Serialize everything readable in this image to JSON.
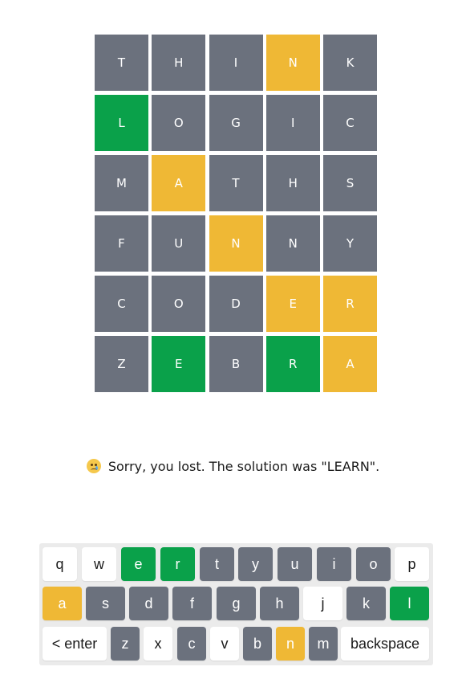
{
  "board": {
    "rows": [
      [
        {
          "letter": "T",
          "state": "absent"
        },
        {
          "letter": "H",
          "state": "absent"
        },
        {
          "letter": "I",
          "state": "absent"
        },
        {
          "letter": "N",
          "state": "present"
        },
        {
          "letter": "K",
          "state": "absent"
        }
      ],
      [
        {
          "letter": "L",
          "state": "correct"
        },
        {
          "letter": "O",
          "state": "absent"
        },
        {
          "letter": "G",
          "state": "absent"
        },
        {
          "letter": "I",
          "state": "absent"
        },
        {
          "letter": "C",
          "state": "absent"
        }
      ],
      [
        {
          "letter": "M",
          "state": "absent"
        },
        {
          "letter": "A",
          "state": "present"
        },
        {
          "letter": "T",
          "state": "absent"
        },
        {
          "letter": "H",
          "state": "absent"
        },
        {
          "letter": "S",
          "state": "absent"
        }
      ],
      [
        {
          "letter": "F",
          "state": "absent"
        },
        {
          "letter": "U",
          "state": "absent"
        },
        {
          "letter": "N",
          "state": "present"
        },
        {
          "letter": "N",
          "state": "absent"
        },
        {
          "letter": "Y",
          "state": "absent"
        }
      ],
      [
        {
          "letter": "C",
          "state": "absent"
        },
        {
          "letter": "O",
          "state": "absent"
        },
        {
          "letter": "D",
          "state": "absent"
        },
        {
          "letter": "E",
          "state": "present"
        },
        {
          "letter": "R",
          "state": "present"
        }
      ],
      [
        {
          "letter": "Z",
          "state": "absent"
        },
        {
          "letter": "E",
          "state": "correct"
        },
        {
          "letter": "B",
          "state": "absent"
        },
        {
          "letter": "R",
          "state": "correct"
        },
        {
          "letter": "A",
          "state": "present"
        }
      ]
    ]
  },
  "message": {
    "emoji_icon": "crying-face-icon",
    "text": "Sorry, you lost. The solution was \"LEARN\"."
  },
  "keyboard": {
    "rows": [
      [
        {
          "label": "q",
          "state": "unused"
        },
        {
          "label": "w",
          "state": "unused"
        },
        {
          "label": "e",
          "state": "correct"
        },
        {
          "label": "r",
          "state": "correct"
        },
        {
          "label": "t",
          "state": "absent"
        },
        {
          "label": "y",
          "state": "absent"
        },
        {
          "label": "u",
          "state": "absent"
        },
        {
          "label": "i",
          "state": "absent"
        },
        {
          "label": "o",
          "state": "absent"
        },
        {
          "label": "p",
          "state": "unused"
        }
      ],
      [
        {
          "label": "a",
          "state": "present"
        },
        {
          "label": "s",
          "state": "absent"
        },
        {
          "label": "d",
          "state": "absent"
        },
        {
          "label": "f",
          "state": "absent"
        },
        {
          "label": "g",
          "state": "absent"
        },
        {
          "label": "h",
          "state": "absent"
        },
        {
          "label": "j",
          "state": "unused"
        },
        {
          "label": "k",
          "state": "absent"
        },
        {
          "label": "l",
          "state": "correct"
        }
      ],
      [
        {
          "label": "< enter",
          "state": "unused",
          "role": "enter"
        },
        {
          "label": "z",
          "state": "absent"
        },
        {
          "label": "x",
          "state": "unused"
        },
        {
          "label": "c",
          "state": "absent"
        },
        {
          "label": "v",
          "state": "unused"
        },
        {
          "label": "b",
          "state": "absent"
        },
        {
          "label": "n",
          "state": "present"
        },
        {
          "label": "m",
          "state": "absent"
        },
        {
          "label": "backspace",
          "state": "unused",
          "role": "backspace"
        }
      ]
    ]
  },
  "colors": {
    "absent": "#6b717d",
    "present": "#efb835",
    "correct": "#0aa14a",
    "unused_key": "#ffffff",
    "keyboard_bg": "#ebebeb"
  }
}
